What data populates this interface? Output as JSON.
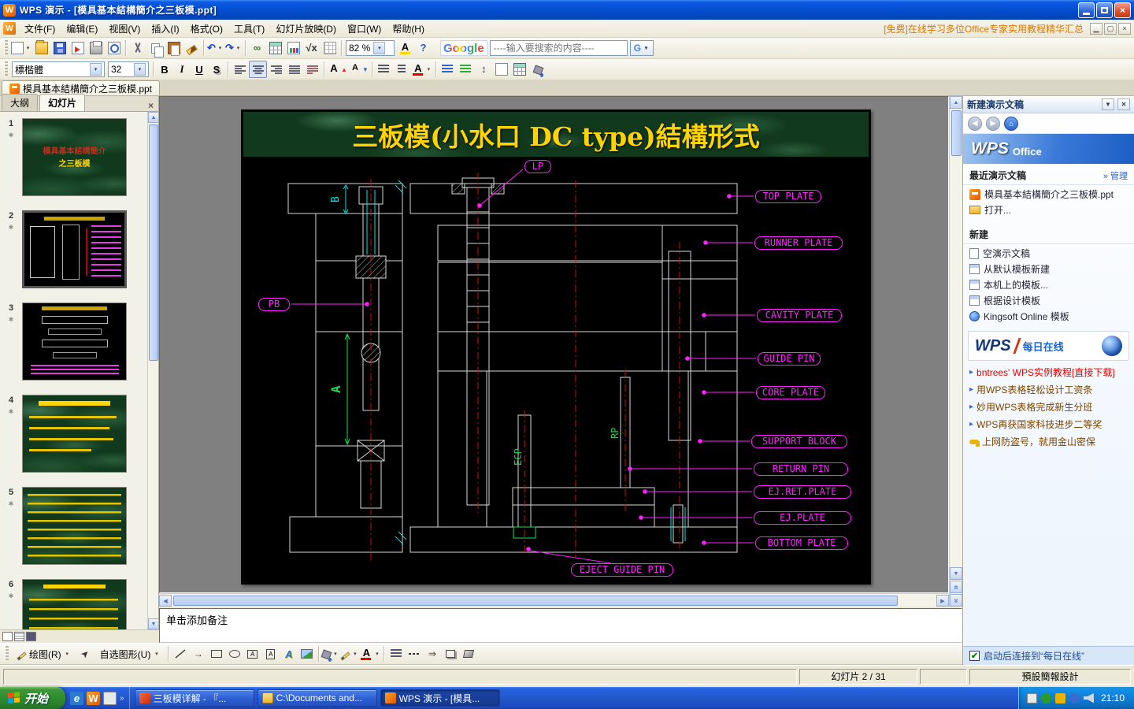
{
  "window": {
    "title": "WPS 演示 - [模具基本結構簡介之三板模.ppt]"
  },
  "menubar": {
    "items": [
      "文件(F)",
      "编辑(E)",
      "视图(V)",
      "插入(I)",
      "格式(O)",
      "工具(T)",
      "幻灯片放映(D)",
      "窗口(W)",
      "帮助(H)"
    ],
    "promo": "[免费]在线学习多位Office专家实用教程精华汇总"
  },
  "toolbar": {
    "zoom_value": "82 %",
    "google_logo": "Google",
    "search_placeholder": "----输入要搜索的内容----",
    "g_button": "G"
  },
  "format_bar": {
    "font_name": "標楷體",
    "font_size": "32",
    "bold": "B",
    "italic": "I",
    "underline": "U",
    "strike": "S"
  },
  "doc_tab": {
    "label": "模具基本結構簡介之三板模.ppt"
  },
  "left_panel": {
    "tab_outline": "大纲",
    "tab_slides": "幻灯片",
    "slide_numbers": [
      "1",
      "2",
      "3",
      "4",
      "5",
      "6"
    ],
    "thumb1_line1": "模具基本結構簡介",
    "thumb1_line2": "之三板模"
  },
  "slide": {
    "title": "三板模(小水口 DC type)結構形式",
    "labels": {
      "lp": "LP",
      "top_plate": "TOP PLATE",
      "runner_plate": "RUNNER PLATE",
      "pb": "PB",
      "cavity_plate": "CAVITY PLATE",
      "guide_pin": "GUIDE PIN",
      "core_plate": "CORE PLATE",
      "support_block": "SUPPORT BLOCK",
      "return_pin": "RETURN PIN",
      "ej_ret_plate": "EJ.RET.PLATE",
      "ej_plate": "EJ.PLATE",
      "bottom_plate": "BOTTOM PLATE",
      "eject_guide_pin": "EJECT GUIDE PIN"
    },
    "annotations": {
      "ecp": "ECP",
      "rp": "RP",
      "dim_a": "A",
      "dim_b": "B"
    }
  },
  "notes": {
    "placeholder": "单击添加备注"
  },
  "task_pane": {
    "title": "新建演示文稿",
    "brand_wps": "WPS",
    "brand_office": "Office",
    "recent_header": "最近演示文稿",
    "manage_link": "» 管理",
    "recent_doc": "模具基本結構簡介之三板模.ppt",
    "open_item": "打开...",
    "new_header": "新建",
    "new_items": [
      "空演示文稿",
      "从默认模板新建",
      "本机上的模板...",
      "根据设计模板",
      "Kingsoft Online 模板"
    ],
    "daily_wps": "WPS",
    "daily_label": "每日在线",
    "links": [
      "bntrees' WPS实例教程[直接下载]",
      "用WPS表格轻松设计工资条",
      "妙用WPS表格完成新生分班",
      "WPS再获国家科技进步二等奖",
      "上网防盗号，就用金山密保"
    ],
    "startup_checkbox": "启动后连接到“每日在线”"
  },
  "draw_bar": {
    "draw": "绘图(R)",
    "autoshapes": "自选图形(U)"
  },
  "status_bar": {
    "slide_info": "幻灯片 2 / 31",
    "template_name": "預設簡報設計"
  },
  "taskbar": {
    "start": "开始",
    "tasks": [
      "三板模详解 - 『...",
      "C:\\Documents and...",
      "WPS 演示 - [模具..."
    ],
    "time": "21:10"
  }
}
